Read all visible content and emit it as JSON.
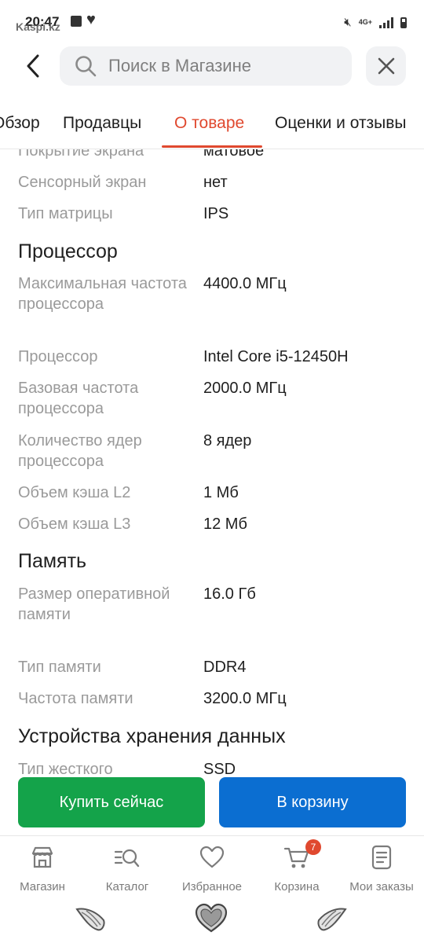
{
  "status_bar": {
    "time": "20:47",
    "watermark": "Kaspi.kz",
    "network_label": "4G+"
  },
  "search": {
    "placeholder": "Поиск в Магазине"
  },
  "tabs": [
    {
      "label": "Обзор"
    },
    {
      "label": "Продавцы"
    },
    {
      "label": "О товаре"
    },
    {
      "label": "Оценки и отзывы"
    }
  ],
  "active_tab_label": "О товаре",
  "specs": {
    "partial_top": {
      "label": "Покрытие экрана",
      "value": "матовое"
    },
    "display_rows": [
      {
        "label": "Сенсорный экран",
        "value": "нет"
      },
      {
        "label": "Тип матрицы",
        "value": "IPS"
      }
    ],
    "cpu_title": "Процессор",
    "cpu_rows": [
      {
        "label": "Максимальная частота процессора",
        "value": "4400.0 МГц"
      },
      {
        "label": "Процессор",
        "value": "Intel Core i5-12450H"
      },
      {
        "label": "Базовая частота процессора",
        "value": "2000.0 МГц"
      },
      {
        "label": "Количество ядер процессора",
        "value": "8 ядер"
      },
      {
        "label": "Объем кэша L2",
        "value": "1 Мб"
      },
      {
        "label": "Объем кэша L3",
        "value": "12 Мб"
      }
    ],
    "memory_title": "Память",
    "memory_rows": [
      {
        "label": "Размер оперативной памяти",
        "value": "16.0 Гб"
      },
      {
        "label": "Тип памяти",
        "value": "DDR4"
      },
      {
        "label": "Частота памяти",
        "value": "3200.0 МГц"
      }
    ],
    "storage_title": "Устройства хранения данных",
    "partial_bottom": {
      "label": "Тип жесткого",
      "value": "SSD"
    }
  },
  "actions": {
    "buy_now": "Купить сейчас",
    "add_to_cart": "В корзину"
  },
  "bottom_nav": [
    {
      "label": "Магазин",
      "icon": "store-icon"
    },
    {
      "label": "Каталог",
      "icon": "catalog-search-icon"
    },
    {
      "label": "Избранное",
      "icon": "heart-icon"
    },
    {
      "label": "Корзина",
      "icon": "cart-icon",
      "badge": "7"
    },
    {
      "label": "Мои заказы",
      "icon": "orders-icon"
    }
  ],
  "colors": {
    "accent": "#e0492f",
    "buy_button": "#14a34a",
    "cart_button": "#0b6ed1",
    "label_gray": "#9a9a9a"
  }
}
